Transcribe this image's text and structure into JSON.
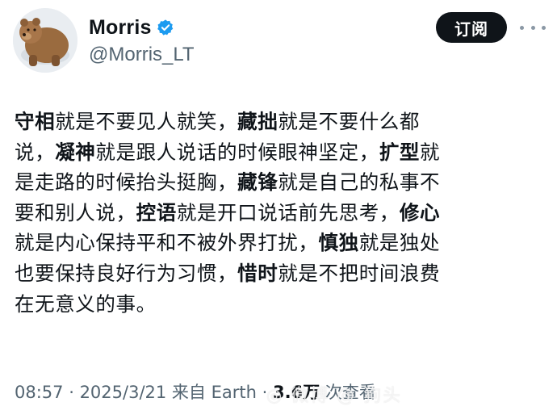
{
  "author": {
    "display_name": "Morris",
    "handle": "@Morris_LT",
    "verified": true,
    "avatar_icon": "bear-avatar"
  },
  "actions": {
    "subscribe_label": "订阅",
    "more_icon": "more-dots-icon"
  },
  "tweet": {
    "lines": [
      [
        {
          "t": "守相",
          "b": true
        },
        {
          "t": "就是不要见人就笑，",
          "b": false
        },
        {
          "t": "藏拙",
          "b": true
        },
        {
          "t": "就是不要什么都",
          "b": false
        }
      ],
      [
        {
          "t": "说，",
          "b": false
        },
        {
          "t": "凝神",
          "b": true
        },
        {
          "t": "就是跟人说话的时候眼神坚定，",
          "b": false
        },
        {
          "t": "扩型",
          "b": true
        },
        {
          "t": "就",
          "b": false
        }
      ],
      [
        {
          "t": "是走路的时候抬头挺胸，",
          "b": false
        },
        {
          "t": "藏锋",
          "b": true
        },
        {
          "t": "就是自己的私事不",
          "b": false
        }
      ],
      [
        {
          "t": "要和别人说，",
          "b": false
        },
        {
          "t": "控语",
          "b": true
        },
        {
          "t": "就是开口说话前先思考，",
          "b": false
        },
        {
          "t": "修心",
          "b": true
        }
      ],
      [
        {
          "t": "就是内心保持平和不被外界打扰，",
          "b": false
        },
        {
          "t": "慎独",
          "b": true
        },
        {
          "t": "就是独处",
          "b": false
        }
      ],
      [
        {
          "t": "也要保持良好行为习惯，",
          "b": false
        },
        {
          "t": "惜时",
          "b": true
        },
        {
          "t": "就是不把时间浪费",
          "b": false
        }
      ],
      [
        {
          "t": "在无意义的事。",
          "b": false
        }
      ]
    ]
  },
  "meta": {
    "time": "08:57",
    "sep1": " · ",
    "date": "2025/3/21",
    "source": " 来自 Earth",
    "sep2": " · ",
    "views": "3.6万",
    "views_suffix": " 次查看"
  },
  "watermark": {
    "text": "◎ 微博 @ 狗头"
  },
  "colors": {
    "text": "#0f1419",
    "secondary": "#536471",
    "verified_blue": "#1d9bf0",
    "button_bg": "#0f1419"
  }
}
